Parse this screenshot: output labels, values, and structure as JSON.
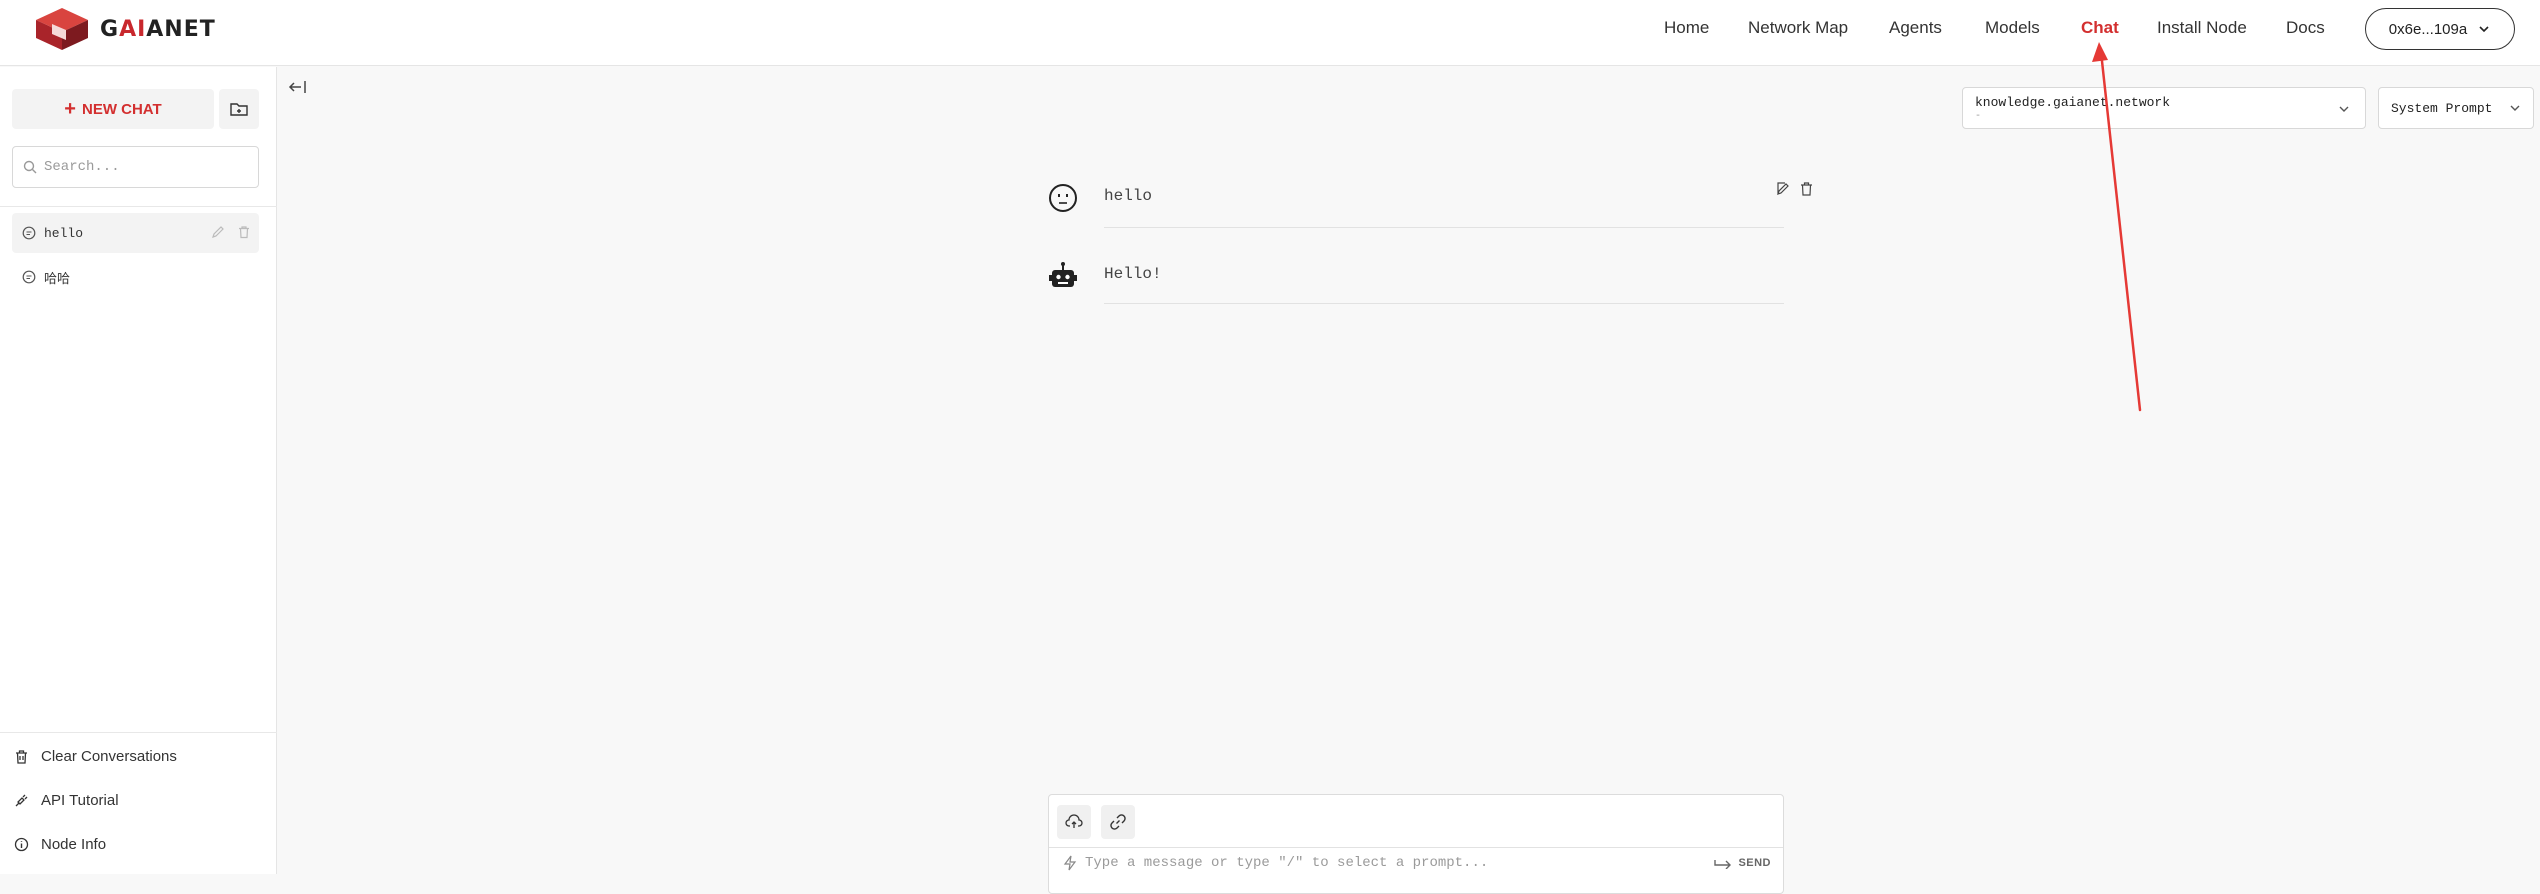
{
  "brand": {
    "logo_text_pre": "G",
    "logo_text_ai": "AI",
    "logo_text_post": "ANET"
  },
  "nav": {
    "items": [
      {
        "label": "Home"
      },
      {
        "label": "Network Map"
      },
      {
        "label": "Agents"
      },
      {
        "label": "Models"
      },
      {
        "label": "Chat",
        "active": true
      },
      {
        "label": "Install Node"
      },
      {
        "label": "Docs"
      }
    ],
    "wallet": "0x6e...109a"
  },
  "sidebar": {
    "new_chat_label": "NEW CHAT",
    "search_placeholder": "Search...",
    "conversations": [
      {
        "label": "hello",
        "icon": "chat-bubble-icon"
      },
      {
        "label": "哈哈",
        "icon": "chat-bubble-icon"
      }
    ],
    "bottom_links": [
      {
        "label": "Clear Conversations",
        "icon": "trash-icon"
      },
      {
        "label": "API Tutorial",
        "icon": "plug-icon"
      },
      {
        "label": "Node Info",
        "icon": "info-icon"
      }
    ]
  },
  "main": {
    "model": {
      "name": "knowledge.gaianet.network",
      "sub": "-"
    },
    "system_prompt_label": "System Prompt",
    "messages": [
      {
        "role": "user",
        "text": "hello"
      },
      {
        "role": "assistant",
        "text": "Hello!"
      }
    ],
    "composer": {
      "placeholder": "Type a message or type \"/\" to select a prompt...",
      "send_label": "SEND"
    }
  },
  "colors": {
    "accent": "#d32f2f",
    "annotation_arrow": "#e53935"
  }
}
